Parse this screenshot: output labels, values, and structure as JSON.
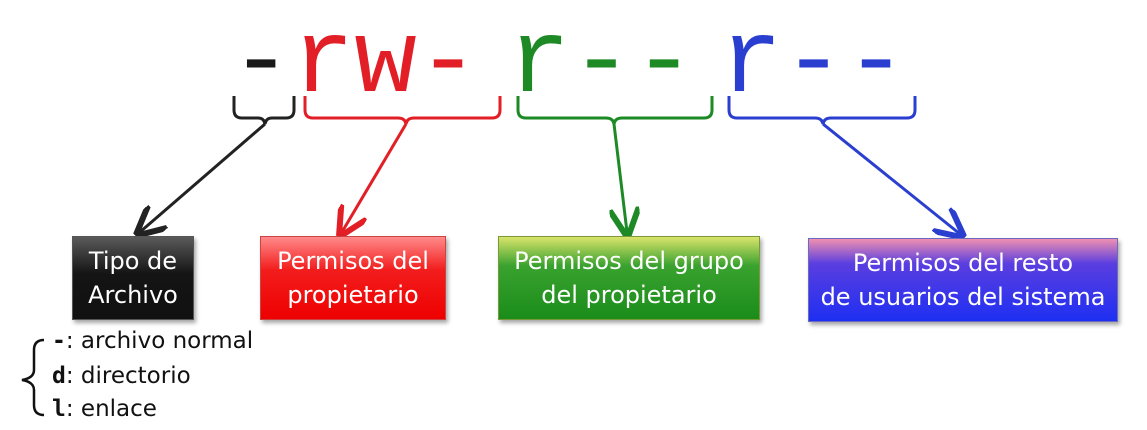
{
  "permission_string": {
    "type_char": "-",
    "owner_chars": "rw-",
    "group_chars": "r--",
    "others_chars": "r--"
  },
  "colors": {
    "type": "#1a1a1a",
    "owner": "#e21f26",
    "group": "#1d8a26",
    "others": "#2a3fd0"
  },
  "boxes": {
    "type_label": "Tipo de\nArchivo",
    "owner_label": "Permisos del\npropietario",
    "group_label": "Permisos del grupo\ndel propietario",
    "others_label": "Permisos del resto\nde usuarios del sistema"
  },
  "legend": {
    "items": [
      {
        "code": "-",
        "text": ": archivo normal"
      },
      {
        "code": "d",
        "text": ": directorio"
      },
      {
        "code": "l",
        "text": ": enlace"
      }
    ]
  }
}
